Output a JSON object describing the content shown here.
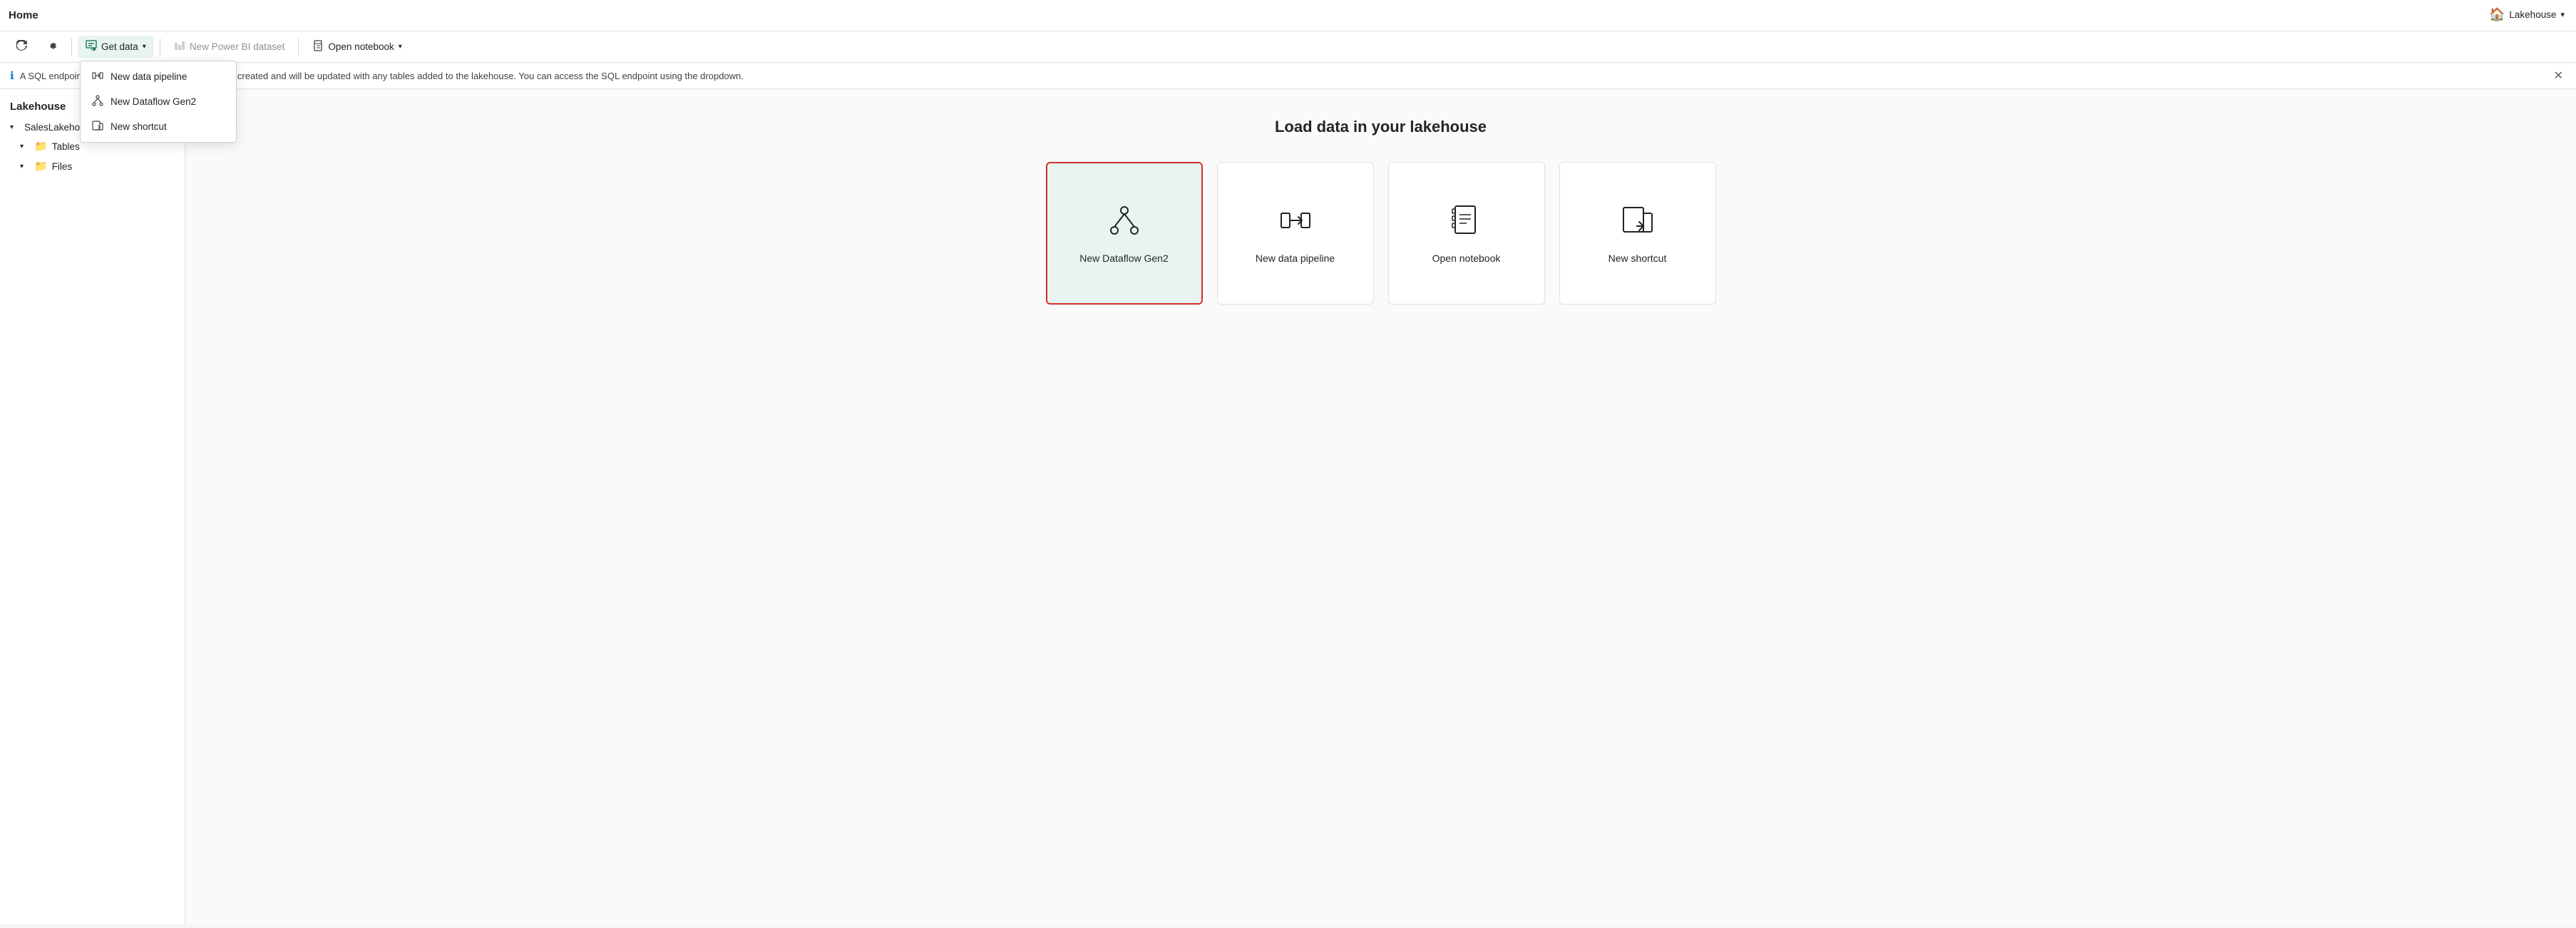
{
  "header": {
    "title": "Home",
    "workspace": "Lakehouse"
  },
  "toolbar": {
    "refresh_label": "Refresh",
    "settings_label": "Settings",
    "get_data_label": "Get data",
    "new_power_bi_label": "New Power BI dataset",
    "open_notebook_label": "Open notebook"
  },
  "dropdown": {
    "items": [
      {
        "id": "new-data-pipeline",
        "label": "New data pipeline"
      },
      {
        "id": "new-dataflow-gen2",
        "label": "New Dataflow Gen2"
      },
      {
        "id": "new-shortcut",
        "label": "New shortcut"
      }
    ]
  },
  "info_bar": {
    "text": "A SQL endpoint default dataset for reporting is being created and will be updated with any tables added to the lakehouse. You can access the SQL endpoint using the dropdown."
  },
  "sidebar": {
    "title": "Lakehouse",
    "root_item": "SalesLakehouse",
    "items": [
      {
        "label": "Tables"
      },
      {
        "label": "Files"
      }
    ]
  },
  "content": {
    "title": "Load data in your lakehouse",
    "cards": [
      {
        "id": "new-dataflow-gen2",
        "label": "New Dataflow Gen2",
        "highlighted": true
      },
      {
        "id": "new-data-pipeline",
        "label": "New data pipeline",
        "highlighted": false
      },
      {
        "id": "open-notebook",
        "label": "Open notebook",
        "highlighted": false
      },
      {
        "id": "new-shortcut",
        "label": "New shortcut",
        "highlighted": false
      }
    ]
  },
  "icons": {
    "chevron_down": "▾",
    "chevron_right": "›",
    "chevron_left": "‹",
    "close": "✕",
    "info": "ⓘ",
    "house": "⌂"
  }
}
